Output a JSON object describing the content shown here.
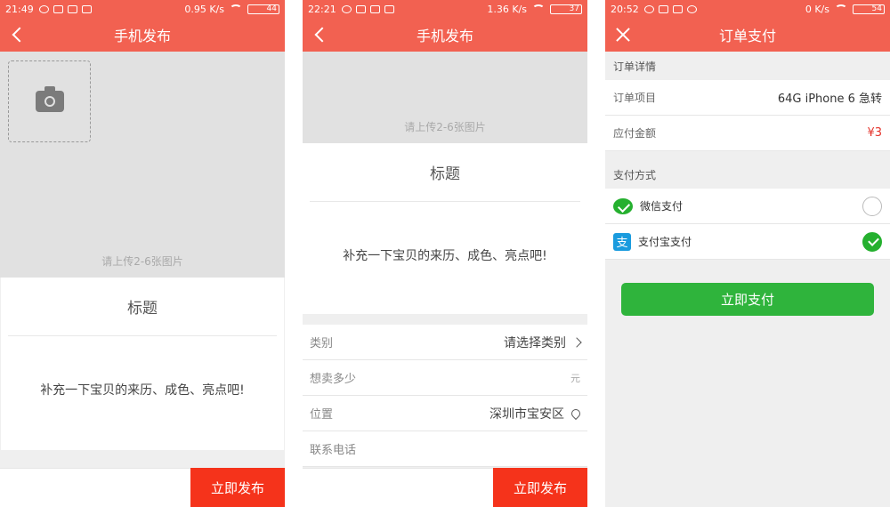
{
  "screen1": {
    "status": {
      "time": "21:49",
      "net": "0.95 K/s",
      "battery": "44"
    },
    "title": "手机发布",
    "upload_hint": "请上传2-6张图片",
    "title_placeholder": "标题",
    "desc_placeholder": "补充一下宝贝的来历、成色、亮点吧!",
    "publish_label": "立即发布"
  },
  "screen2": {
    "status": {
      "time": "22:21",
      "net": "1.36 K/s",
      "battery": "37"
    },
    "title": "手机发布",
    "upload_hint": "请上传2-6张图片",
    "title_placeholder": "标题",
    "desc_placeholder": "补充一下宝贝的来历、成色、亮点吧!",
    "form": {
      "category_label": "类别",
      "category_value": "请选择类别",
      "price_label": "想卖多少",
      "price_unit": "元",
      "location_label": "位置",
      "location_value": "深圳市宝安区",
      "phone_label": "联系电话"
    },
    "publish_label": "立即发布"
  },
  "screen3": {
    "status": {
      "time": "20:52",
      "net": "0 K/s",
      "battery": "54"
    },
    "title": "订单支付",
    "order_section": "订单详情",
    "item_label": "订单项目",
    "item_value": "64G iPhone 6 急转",
    "amount_label": "应付金额",
    "amount_value": "¥3",
    "pay_section": "支付方式",
    "methods": [
      {
        "label": "微信支付",
        "selected": false
      },
      {
        "label": "支付宝支付",
        "selected": true
      }
    ],
    "pay_button": "立即支付"
  },
  "colors": {
    "brand": "#f26151",
    "publish": "#f5331b",
    "pay_green": "#2fb43c",
    "price_red": "#e4332b"
  }
}
